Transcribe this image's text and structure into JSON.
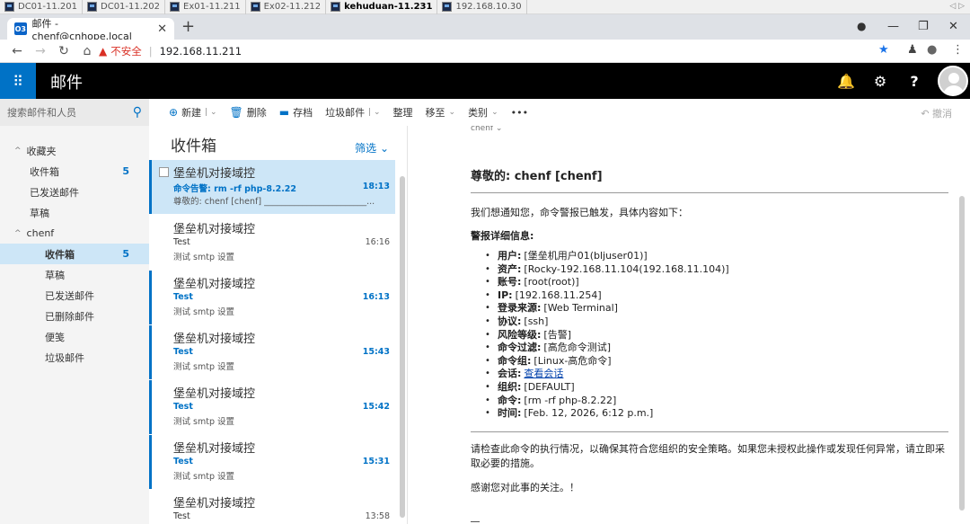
{
  "remote_tabs": [
    {
      "label": "DC01-11.201",
      "active": false
    },
    {
      "label": "DC01-11.202",
      "active": false
    },
    {
      "label": "Ex01-11.211",
      "active": false
    },
    {
      "label": "Ex02-11.212",
      "active": false
    },
    {
      "label": "kehuduan-11.231",
      "active": true
    },
    {
      "label": "192.168.10.30",
      "active": false
    }
  ],
  "browser": {
    "tab_title": "邮件 - chenf@cnhope.local",
    "tab_icon": "O3",
    "insecure_label": "不安全",
    "url": "192.168.11.211"
  },
  "app": {
    "title": "邮件"
  },
  "search": {
    "placeholder": "搜索邮件和人员"
  },
  "toolbar": {
    "new_label": "新建",
    "delete_label": "删除",
    "archive_label": "存档",
    "junk_label": "垃圾邮件",
    "sweep_label": "整理",
    "move_label": "移至",
    "category_label": "类别",
    "more_label": "•••",
    "undo_label": "撤消"
  },
  "nav": {
    "favorites_label": "收藏夹",
    "favorites": [
      {
        "label": "收件箱",
        "count": "5"
      },
      {
        "label": "已发送邮件",
        "count": ""
      },
      {
        "label": "草稿",
        "count": ""
      }
    ],
    "account_label": "chenf",
    "folders": [
      {
        "label": "收件箱",
        "count": "5"
      },
      {
        "label": "草稿",
        "count": ""
      },
      {
        "label": "已发送邮件",
        "count": ""
      },
      {
        "label": "已删除邮件",
        "count": ""
      },
      {
        "label": "便笺",
        "count": ""
      },
      {
        "label": "垃圾邮件",
        "count": ""
      }
    ]
  },
  "list": {
    "title": "收件箱",
    "filter_label": "筛选",
    "messages": [
      {
        "sender": "堡垒机对接域控",
        "subject": "命令告警: rm -rf php-8.2.22",
        "time": "18:13",
        "preview": "尊敬的: chenf [chenf] ________________________...",
        "state": "selected"
      },
      {
        "sender": "堡垒机对接域控",
        "subject": "Test",
        "time": "16:16",
        "preview": "测试 smtp 设置",
        "state": "read"
      },
      {
        "sender": "堡垒机对接域控",
        "subject": "Test",
        "time": "16:13",
        "preview": "测试 smtp 设置",
        "state": "unread"
      },
      {
        "sender": "堡垒机对接域控",
        "subject": "Test",
        "time": "15:43",
        "preview": "测试 smtp 设置",
        "state": "unread"
      },
      {
        "sender": "堡垒机对接域控",
        "subject": "Test",
        "time": "15:42",
        "preview": "测试 smtp 设置",
        "state": "unread"
      },
      {
        "sender": "堡垒机对接域控",
        "subject": "Test",
        "time": "15:31",
        "preview": "测试 smtp 设置",
        "state": "unread"
      },
      {
        "sender": "堡垒机对接域控",
        "subject": "Test",
        "time": "13:58",
        "preview": "",
        "state": "read"
      }
    ]
  },
  "reading": {
    "from_label": "chenf ⌄",
    "greeting": "尊敬的: chenf [chenf]",
    "intro": "我们想通知您，命令警报已触发，具体内容如下：",
    "details_heading": "警报详细信息:",
    "details": [
      {
        "key": "用户:",
        "value": "[堡垒机用户01(bljuser01)]"
      },
      {
        "key": "资产:",
        "value": "[Rocky-192.168.11.104(192.168.11.104)]"
      },
      {
        "key": "账号:",
        "value": "[root(root)]"
      },
      {
        "key": "IP:",
        "value": "[192.168.11.254]"
      },
      {
        "key": "登录来源:",
        "value": "[Web Terminal]"
      },
      {
        "key": "协议:",
        "value": "[ssh]"
      },
      {
        "key": "风险等级:",
        "value": "[告警]"
      },
      {
        "key": "命令过滤:",
        "value": "[高危命令测试]"
      },
      {
        "key": "命令组:",
        "value": "[Linux-高危命令]"
      },
      {
        "key": "会话:",
        "value": "查看会话"
      },
      {
        "key": "组织:",
        "value": "[DEFAULT]"
      },
      {
        "key": "命令:",
        "value": "[rm -rf php-8.2.22]"
      },
      {
        "key": "时间:",
        "value": "[Feb. 12, 2026, 6:12 p.m.]"
      }
    ],
    "advice": "请检查此命令的执行情况，以确保其符合您组织的安全策略。如果您未授权此操作或发现任何异常，请立即采取必要的措施。",
    "thanks": "感谢您对此事的关注。！"
  },
  "colors": {
    "accent": "#0072c6",
    "header": "#000000",
    "selected": "#cde6f7",
    "danger": "#d93025"
  }
}
